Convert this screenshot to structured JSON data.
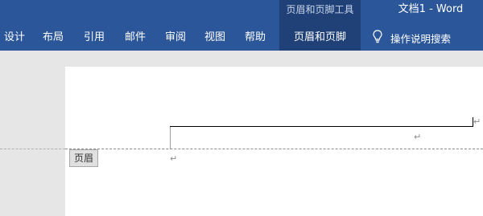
{
  "window": {
    "context_tab_group": "页眉和页脚工具",
    "title": "文档1  -  Word"
  },
  "ribbon": {
    "tabs": [
      {
        "label": "设计"
      },
      {
        "label": "布局"
      },
      {
        "label": "引用"
      },
      {
        "label": "邮件"
      },
      {
        "label": "审阅"
      },
      {
        "label": "视图"
      },
      {
        "label": "帮助"
      },
      {
        "label": "页眉和页脚"
      }
    ],
    "tell_me": {
      "label": "操作说明搜索",
      "icon": "lightbulb-icon"
    }
  },
  "document": {
    "paragraph_mark": "↵",
    "header_tag": "页眉"
  },
  "colors": {
    "ribbon": "#2b579a",
    "context_group": "#1f4178",
    "page": "#ffffff",
    "workspace": "#e6e6e6"
  }
}
